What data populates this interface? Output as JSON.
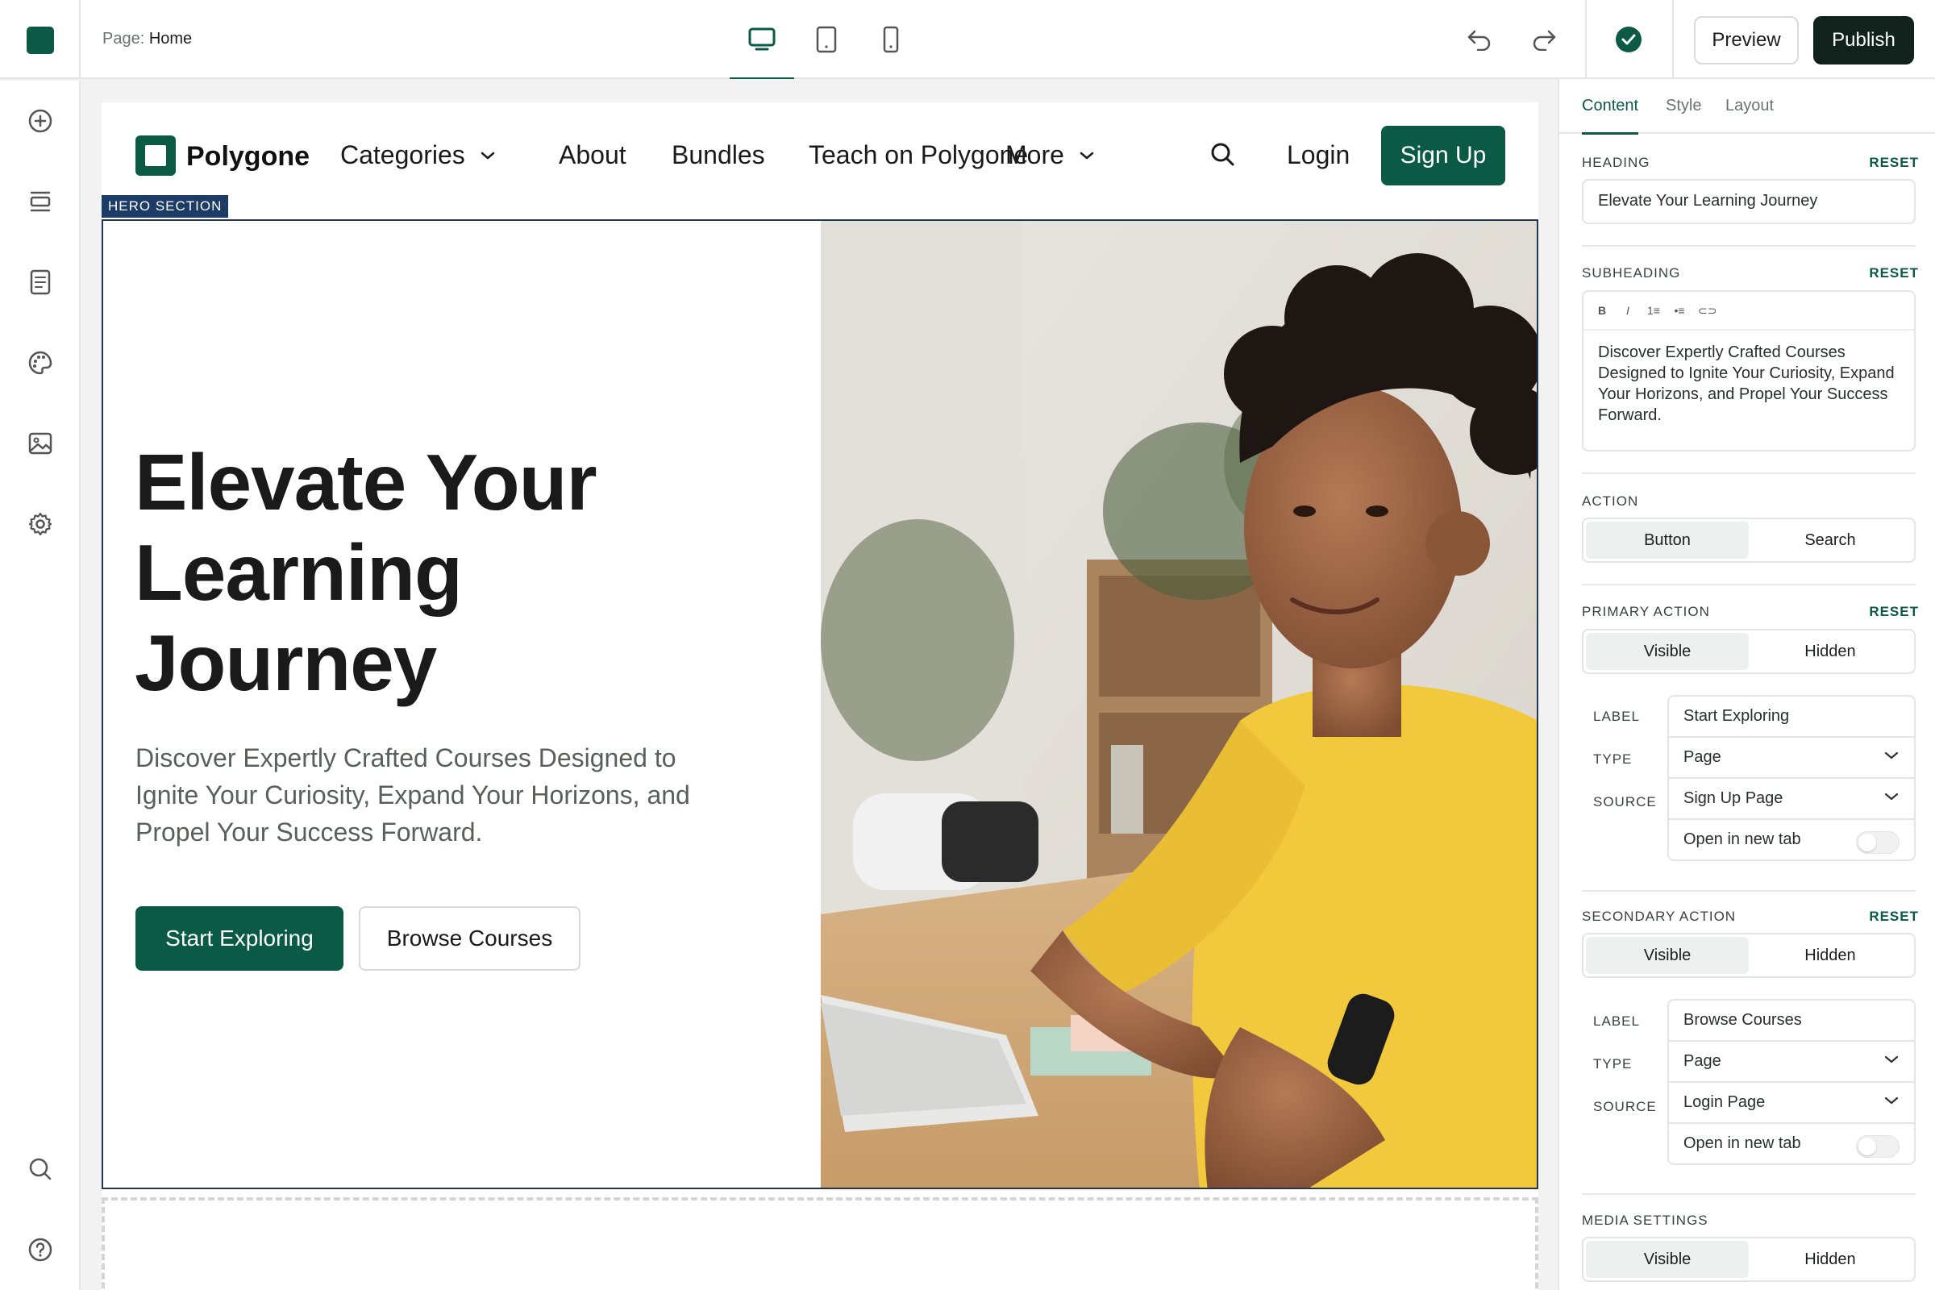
{
  "topbar": {
    "page_prefix": "Page:",
    "page_name": "Home",
    "devices": [
      "desktop-icon",
      "tablet-icon",
      "mobile-icon"
    ],
    "preview_label": "Preview",
    "publish_label": "Publish"
  },
  "rail": {
    "icons": [
      "add-icon",
      "sections-icon",
      "pages-icon",
      "theme-palette-icon",
      "media-icon",
      "settings-icon",
      "search-icon",
      "help-icon"
    ]
  },
  "site": {
    "brand": "Polygone",
    "nav": {
      "categories": "Categories",
      "about": "About",
      "bundles": "Bundles",
      "teach": "Teach on Polygone",
      "more": "More",
      "login": "Login",
      "signup": "Sign Up"
    },
    "hero_tag": "HERO SECTION",
    "hero": {
      "title_line1": "Elevate Your",
      "title_line2": "Learning",
      "title_line3": "Journey",
      "subtitle": "Discover Expertly Crafted Courses Designed to Ignite Your Curiosity, Expand Your Horizons, and Propel Your Success Forward.",
      "primary_button": "Start Exploring",
      "secondary_button": "Browse Courses"
    }
  },
  "panel": {
    "tabs": [
      "Content",
      "Style",
      "Layout"
    ],
    "active_tab": "Content",
    "reset_label": "RESET",
    "heading": {
      "label": "HEADING",
      "value": "Elevate Your Learning Journey"
    },
    "subheading": {
      "label": "SUBHEADING",
      "toolbar": [
        "B",
        "I",
        "1≡",
        "•≡",
        "⊂⊃"
      ],
      "value": "Discover Expertly Crafted Courses Designed to Ignite Your Curiosity, Expand Your Horizons, and Propel Your Success Forward."
    },
    "action": {
      "label": "ACTION",
      "options": [
        "Button",
        "Search"
      ],
      "selected": "Button"
    },
    "primary_action": {
      "label": "PRIMARY ACTION",
      "options": [
        "Visible",
        "Hidden"
      ],
      "selected": "Visible",
      "label_key": "LABEL",
      "label_value": "Start Exploring",
      "type_key": "TYPE",
      "type_value": "Page",
      "source_key": "SOURCE",
      "source_value": "Sign Up Page",
      "new_tab": "Open in new tab",
      "new_tab_on": false
    },
    "secondary_action": {
      "label": "SECONDARY ACTION",
      "options": [
        "Visible",
        "Hidden"
      ],
      "selected": "Visible",
      "label_key": "LABEL",
      "label_value": "Browse Courses",
      "type_key": "TYPE",
      "type_value": "Page",
      "source_key": "SOURCE",
      "source_value": "Login Page",
      "new_tab": "Open in new tab",
      "new_tab_on": false
    },
    "media_settings": {
      "label": "MEDIA SETTINGS",
      "options": [
        "Visible",
        "Hidden"
      ],
      "selected": "Visible"
    }
  },
  "colors": {
    "brand_green": "#0a5a45",
    "publish_dark": "#11211c",
    "hero_tag_blue": "#1c3b66"
  }
}
